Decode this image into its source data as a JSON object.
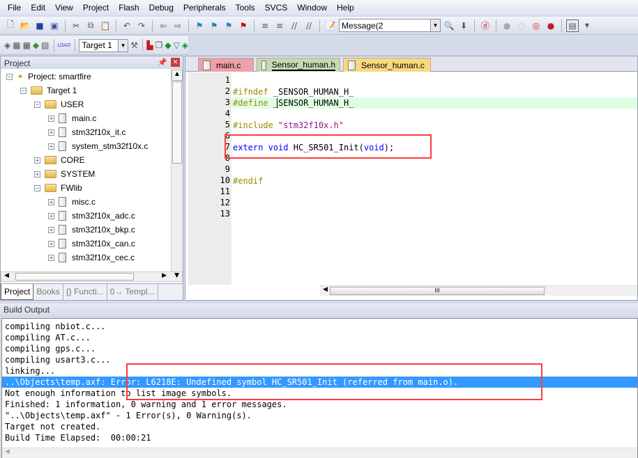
{
  "menu": [
    "File",
    "Edit",
    "View",
    "Project",
    "Flash",
    "Debug",
    "Peripherals",
    "Tools",
    "SVCS",
    "Window",
    "Help"
  ],
  "toolbar": {
    "find_combo": "Message(2",
    "target_combo": "Target 1"
  },
  "project_panel": {
    "title": "Project",
    "tree": [
      {
        "label": "Project: smartfire",
        "level": 0,
        "type": "project",
        "expanded": true
      },
      {
        "label": "Target 1",
        "level": 1,
        "type": "target",
        "expanded": true
      },
      {
        "label": "USER",
        "level": 2,
        "type": "folder",
        "expanded": true
      },
      {
        "label": "main.c",
        "level": 3,
        "type": "file"
      },
      {
        "label": "stm32f10x_it.c",
        "level": 3,
        "type": "file"
      },
      {
        "label": "system_stm32f10x.c",
        "level": 3,
        "type": "file"
      },
      {
        "label": "CORE",
        "level": 2,
        "type": "folder",
        "expanded": false
      },
      {
        "label": "SYSTEM",
        "level": 2,
        "type": "folder",
        "expanded": false
      },
      {
        "label": "FWlib",
        "level": 2,
        "type": "folder",
        "expanded": true
      },
      {
        "label": "misc.c",
        "level": 3,
        "type": "file"
      },
      {
        "label": "stm32f10x_adc.c",
        "level": 3,
        "type": "file"
      },
      {
        "label": "stm32f10x_bkp.c",
        "level": 3,
        "type": "file"
      },
      {
        "label": "stm32f10x_can.c",
        "level": 3,
        "type": "file"
      },
      {
        "label": "stm32f10x_cec.c",
        "level": 3,
        "type": "file"
      }
    ],
    "tabs": [
      "Project",
      "Books",
      "{} Functi...",
      "0→ Templ..."
    ]
  },
  "editor": {
    "tabs": [
      {
        "label": "main.c",
        "color": "#f0a0a8"
      },
      {
        "label": "Sensor_human.h",
        "color": "#c8d8b0",
        "active": true
      },
      {
        "label": "Sensor_human.c",
        "color": "#f8d880"
      }
    ],
    "lines": [
      [],
      [
        {
          "t": "#ifndef",
          "c": "pp"
        },
        {
          "t": " _SENSOR_HUMAN_H_",
          "c": ""
        }
      ],
      [
        {
          "t": "#define",
          "c": "pp"
        },
        {
          "t": " _SENSOR_HUMAN_H_",
          "c": ""
        }
      ],
      [],
      [
        {
          "t": "#include",
          "c": "pp"
        },
        {
          "t": " ",
          "c": ""
        },
        {
          "t": "\"stm32f10x.h\"",
          "c": "str"
        }
      ],
      [],
      [
        {
          "t": "extern",
          "c": "kw"
        },
        {
          "t": " ",
          "c": ""
        },
        {
          "t": "void",
          "c": "kw"
        },
        {
          "t": " HC_SR501_Init(",
          "c": ""
        },
        {
          "t": "void",
          "c": "kw"
        },
        {
          "t": ");",
          "c": ""
        }
      ],
      [],
      [],
      [
        {
          "t": "#endif",
          "c": "pp"
        }
      ],
      [],
      [],
      []
    ],
    "current_line": 3
  },
  "build_output": {
    "title": "Build Output",
    "lines": [
      "compiling nbiot.c...",
      "compiling AT.c...",
      "compiling gps.c...",
      "compiling usart3.c...",
      "linking...",
      "..\\Objects\\temp.axf: Error: L6218E: Undefined symbol HC_SR501_Init (referred from main.o).",
      "Not enough information to list image symbols.",
      "Finished: 1 information, 0 warning and 1 error messages.",
      "\"..\\Objects\\temp.axf\" - 1 Error(s), 0 Warning(s).",
      "Target not created.",
      "Build Time Elapsed:  00:00:21"
    ],
    "selected_index": 5
  },
  "colors": {
    "highlight": "#3399ff",
    "annotation": "#ff3b3b",
    "current_line": "#dfffe4"
  }
}
